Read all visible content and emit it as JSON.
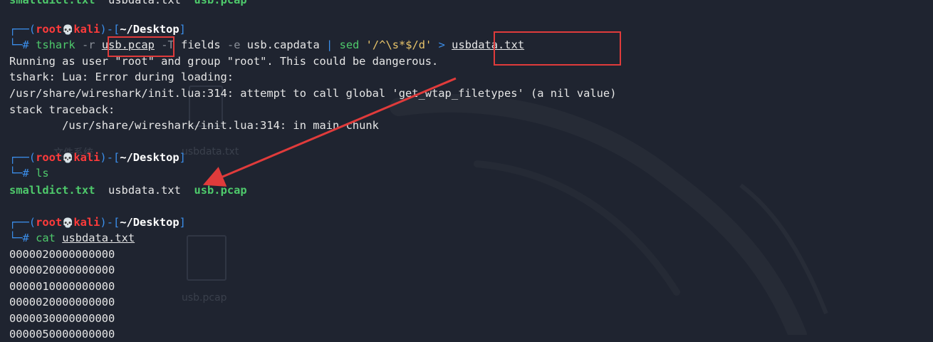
{
  "prev_ls": [
    "smalldict.txt",
    "usbdata.txt",
    "usb.pcap"
  ],
  "prompt1": {
    "open": "┌──(",
    "user": "root",
    "skull": "💀",
    "host": "kali",
    "mid": ")-[",
    "path": "~/Desktop",
    "close": "]",
    "hash": "└─#",
    "cmd": "tshark",
    "flag_r": "-r",
    "file_in": "usb.pcap",
    "flag_T": "-T",
    "arg_fields": "fields",
    "flag_e": "-e",
    "arg_capdata": "usb.capdata",
    "pipe": "|",
    "sed": "sed",
    "sed_expr": "'/^\\s*$/d'",
    "redir": ">",
    "file_out": "usbdata.txt"
  },
  "output1": [
    "Running as user \"root\" and group \"root\". This could be dangerous.",
    "tshark: Lua: Error during loading:",
    "/usr/share/wireshark/init.lua:314: attempt to call global 'get_wtap_filetypes' (a nil value)",
    "stack traceback:",
    "        /usr/share/wireshark/init.lua:314: in main chunk"
  ],
  "prompt2": {
    "cmd": "ls"
  },
  "ls_output": {
    "f1": "smalldict.txt",
    "f2": "usbdata.txt",
    "f3": "usb.pcap"
  },
  "prompt3": {
    "cmd": "cat",
    "arg": "usbdata.txt"
  },
  "cat_output": [
    "0000020000000000",
    "0000020000000000",
    "0000010000000000",
    "0000020000000000",
    "0000030000000000",
    "0000050000000000"
  ],
  "desktop_ghost": {
    "file1": "usbdata.txt",
    "file2": "usb.pcap",
    "folder": "文件系统"
  },
  "colors": {
    "background": "#1f2430",
    "prompt_frame": "#3b8eea",
    "user_host": "#ff3b3b",
    "command": "#4ec96b",
    "annotation": "#e03b3b"
  }
}
